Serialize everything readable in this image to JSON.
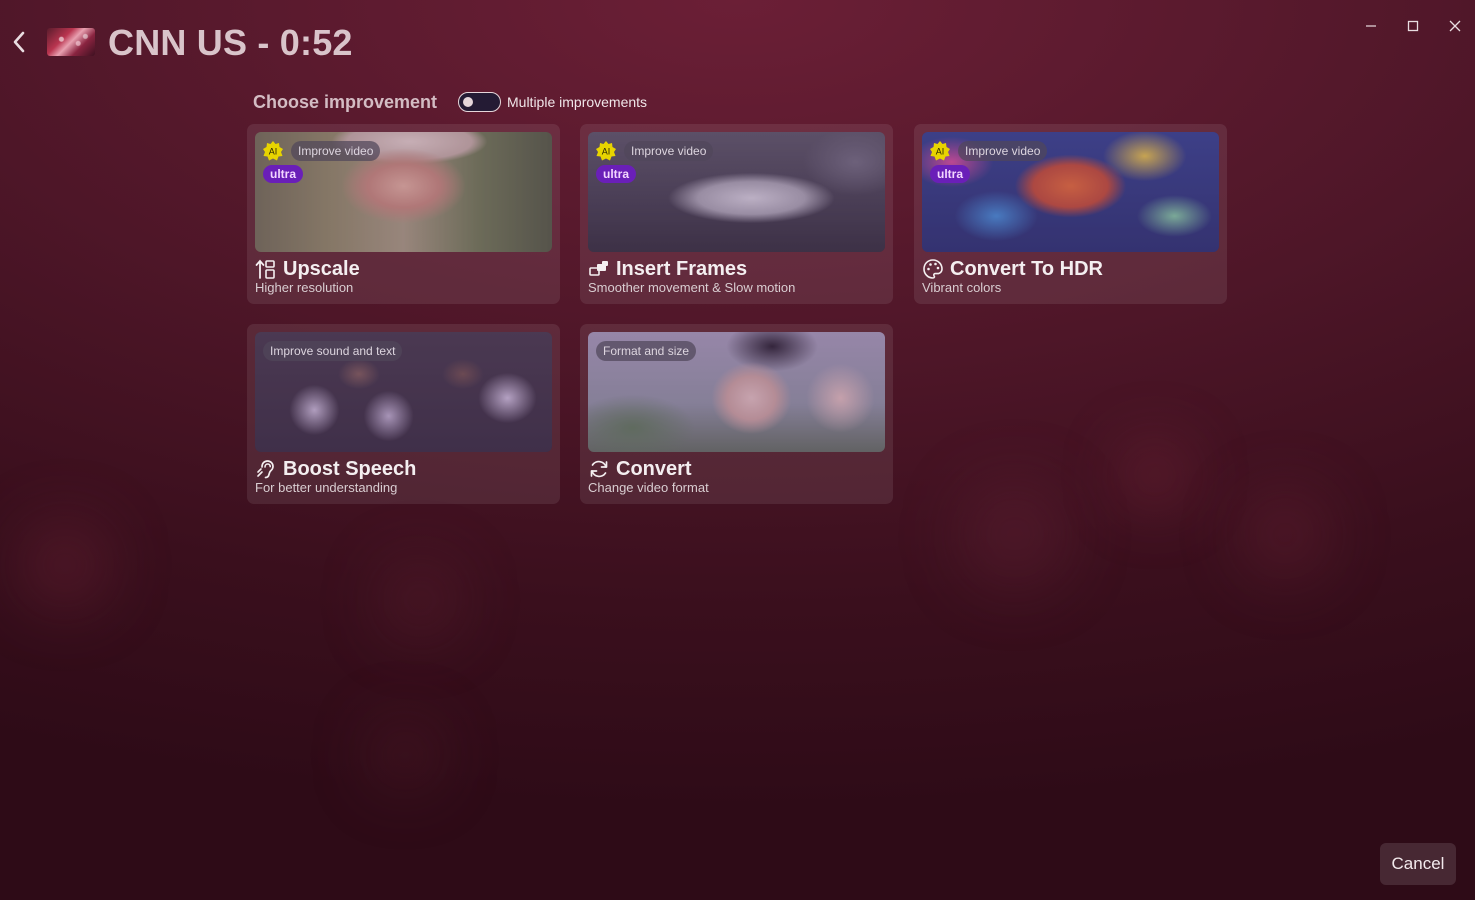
{
  "window": {
    "title": "CNN US - 0:52",
    "controls": [
      "minimize-icon",
      "maximize-icon",
      "close-icon"
    ]
  },
  "header": {
    "section_title": "Choose improvement",
    "multiple_toggle": {
      "label": "Multiple improvements",
      "enabled": false
    }
  },
  "cards": [
    {
      "category": "Improve video",
      "ai": true,
      "ultra_label": "ultra",
      "title": "Upscale",
      "subtitle": "Higher resolution",
      "icon": "upscale-icon"
    },
    {
      "category": "Improve video",
      "ai": true,
      "ultra_label": "ultra",
      "title": "Insert Frames",
      "subtitle": "Smoother movement & Slow motion",
      "icon": "frames-icon"
    },
    {
      "category": "Improve video",
      "ai": true,
      "ultra_label": "ultra",
      "title": "Convert To HDR",
      "subtitle": "Vibrant colors",
      "icon": "palette-icon"
    },
    {
      "category": "Improve sound and text",
      "ai": false,
      "title": "Boost Speech",
      "subtitle": "For better understanding",
      "icon": "hearing-icon"
    },
    {
      "category": "Format and size",
      "ai": false,
      "title": "Convert",
      "subtitle": "Change video format",
      "icon": "refresh-icon"
    }
  ],
  "ai_badge_label": "AI",
  "footer": {
    "cancel_label": "Cancel"
  },
  "colors": {
    "accent_ultra": "#6a1fb8",
    "ai_badge": "#e8d400",
    "background": "#4e1628"
  }
}
